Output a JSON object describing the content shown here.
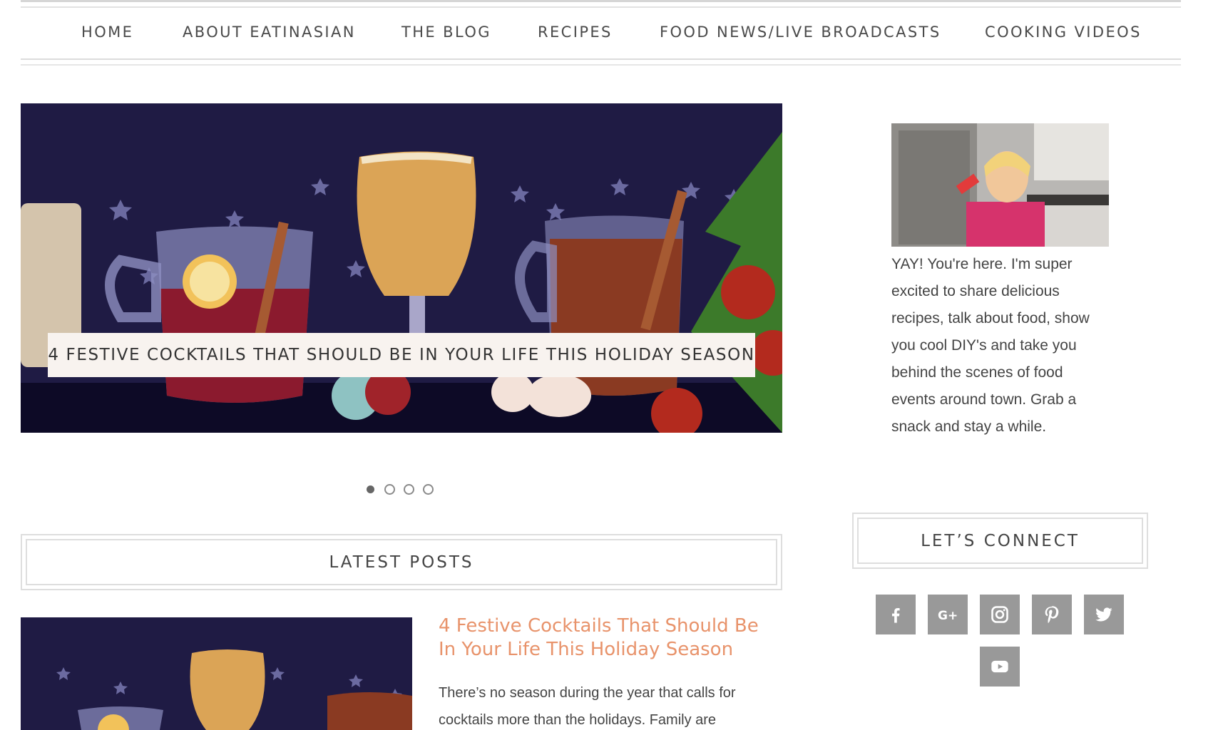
{
  "nav": {
    "items": [
      "HOME",
      "ABOUT EATINASIAN",
      "THE BLOG",
      "RECIPES",
      "FOOD NEWS/LIVE BROADCASTS",
      "COOKING VIDEOS"
    ]
  },
  "hero": {
    "caption": "4 FESTIVE COCKTAILS THAT SHOULD BE IN YOUR LIFE THIS HOLIDAY SEASON",
    "slide_count": 4,
    "active_slide": 1
  },
  "latest": {
    "heading": "LATEST POSTS",
    "post_title": "4 Festive Cocktails That Should Be In Your Life This Holiday Season",
    "post_excerpt": "There’s no season during the year that calls for cocktails more than the holidays. Family are"
  },
  "sidebar": {
    "bio": "YAY! You're here. I'm super excited to share delicious recipes, talk about food, show you cool DIY's and take you behind the scenes of food events around town. Grab a snack and stay a while.",
    "connect_heading": "LET’S CONNECT",
    "social": [
      "facebook-icon",
      "google-plus-icon",
      "instagram-icon",
      "pinterest-icon",
      "twitter-icon",
      "youtube-icon"
    ]
  },
  "colors": {
    "accent": "#e8936b",
    "hero_bg": "#1c1a3f",
    "social_bg": "#999999"
  }
}
